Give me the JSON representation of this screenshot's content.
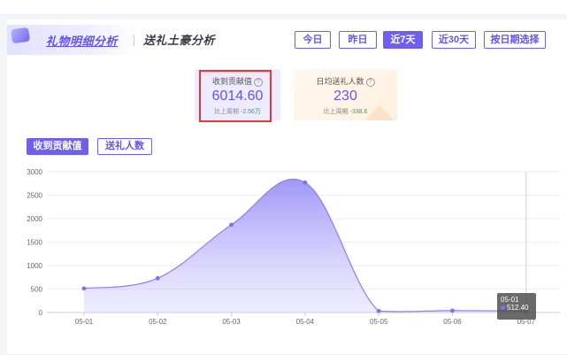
{
  "tabs": {
    "gift_detail": "礼物明细分析",
    "top_gifters": "送礼土豪分析"
  },
  "range_buttons": [
    "今日",
    "昨日",
    "近7天",
    "近30天",
    "按日期选择"
  ],
  "active_range": "近7天",
  "stats": {
    "received": {
      "title": "收到贡献值",
      "value": "6014.60",
      "compare_label": "比上周期",
      "compare_delta": "-2.56万"
    },
    "daily_avg_gifters": {
      "title": "日均送礼人数",
      "value": "230",
      "compare_label": "比上周期",
      "compare_delta": "-338.6"
    }
  },
  "metric_tabs": [
    "收到贡献值",
    "送礼人数"
  ],
  "active_metric": "收到贡献值",
  "colors": {
    "accent": "#6e5ff0",
    "accent_text": "#6454ea",
    "highlight_border": "#e53935",
    "positive": "#2ea36b"
  },
  "chart_data": {
    "type": "area",
    "categories": [
      "05-01",
      "05-02",
      "05-03",
      "05-04",
      "05-05",
      "05-06",
      "05-07"
    ],
    "values": [
      512.4,
      730,
      1870,
      2770,
      30,
      40,
      30
    ],
    "ylim": [
      0,
      3000
    ],
    "yticks": [
      "0",
      "500",
      "1000",
      "1500",
      "2000",
      "2500",
      "3000"
    ],
    "grid": true,
    "tooltip": {
      "date": "05-01",
      "value": "512.40"
    }
  }
}
